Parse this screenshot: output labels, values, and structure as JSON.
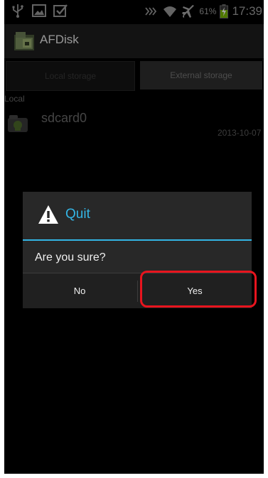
{
  "status_bar": {
    "battery_percent": "61%",
    "clock": "17:39",
    "icons": [
      "usb-icon",
      "image-icon",
      "checkbox-icon",
      "nfc-icon",
      "wifi-icon",
      "airplane-icon",
      "battery-charging-icon"
    ]
  },
  "action_bar": {
    "title": "AFDisk",
    "icon": "app-icon"
  },
  "tabs": [
    {
      "label": "Local storage",
      "selected": true
    },
    {
      "label": "External storage",
      "selected": false
    }
  ],
  "content": {
    "section_label": "Local",
    "storage_item": {
      "name": "sdcard0",
      "date": "2013-10-07"
    }
  },
  "dialog": {
    "title": "Quit",
    "icon": "warning-icon",
    "message": "Are you sure?",
    "buttons": {
      "no": "No",
      "yes": "Yes"
    }
  },
  "colors": {
    "accent": "#33b5e5",
    "highlight": "#e8141e"
  }
}
